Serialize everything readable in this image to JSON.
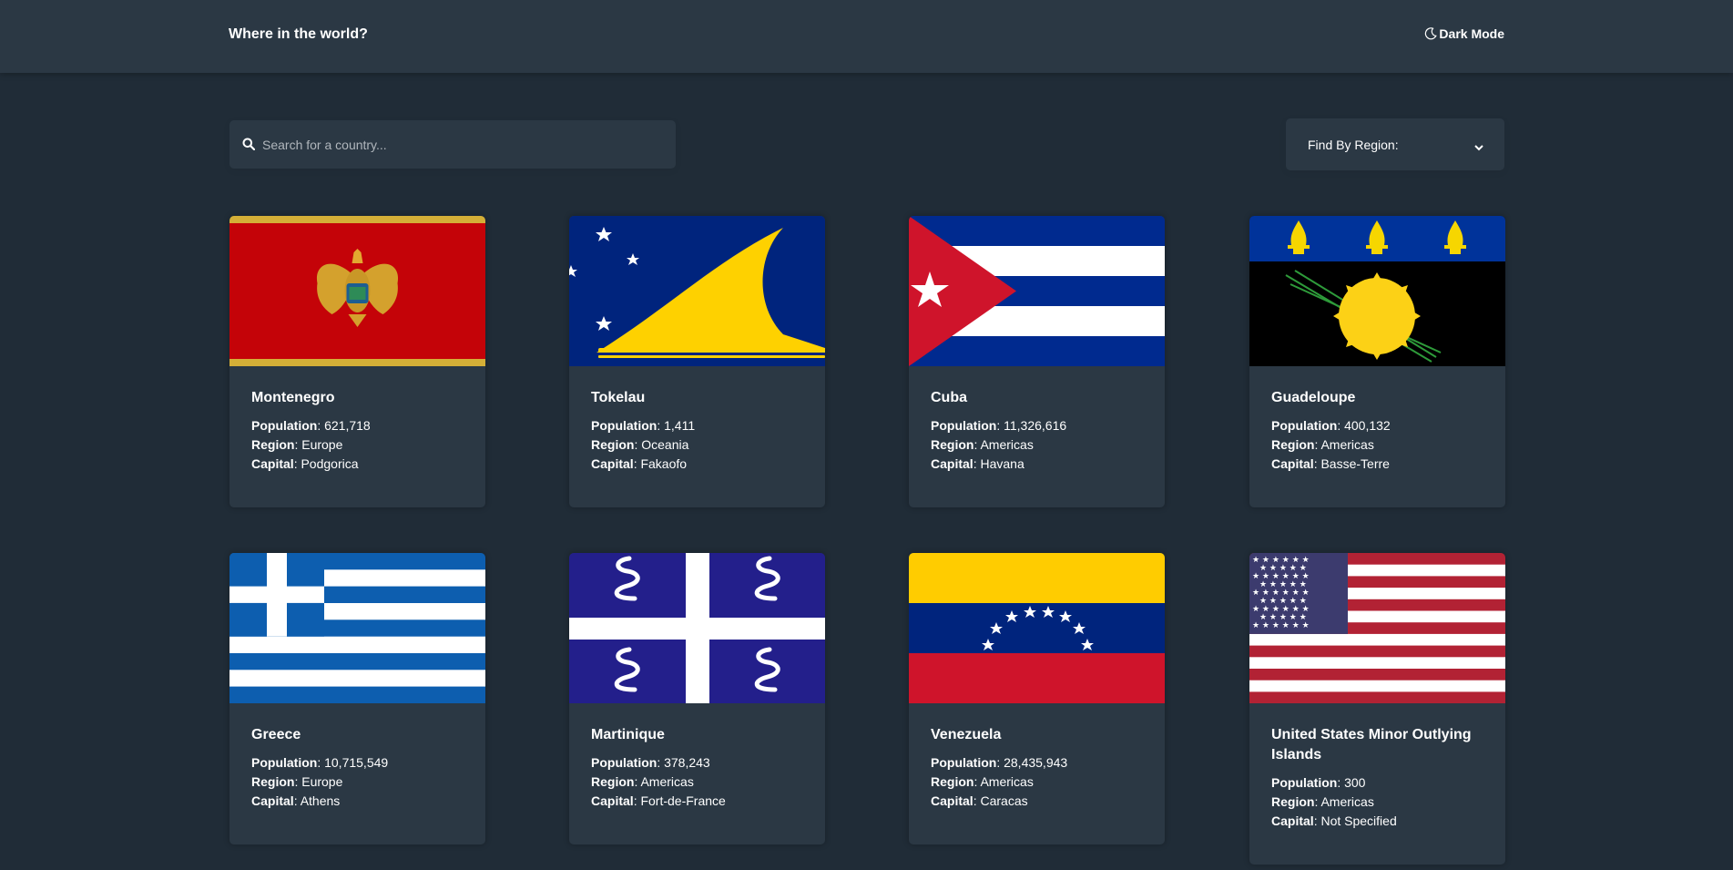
{
  "header": {
    "title": "Where in the world?",
    "mode_label": "Dark Mode",
    "mode_icon": "moon-icon"
  },
  "search": {
    "placeholder": "Search for a country...",
    "value": "",
    "icon": "search-icon"
  },
  "filter": {
    "label": "Find By Region:",
    "icon": "chevron-down-icon"
  },
  "labels": {
    "population": "Population",
    "region": "Region",
    "capital": "Capital"
  },
  "countries": [
    {
      "name": "Montenegro",
      "population": "621,718",
      "region": "Europe",
      "capital": "Podgorica",
      "flag": "montenegro-flag"
    },
    {
      "name": "Tokelau",
      "population": "1,411",
      "region": "Oceania",
      "capital": "Fakaofo",
      "flag": "tokelau-flag"
    },
    {
      "name": "Cuba",
      "population": "11,326,616",
      "region": "Americas",
      "capital": "Havana",
      "flag": "cuba-flag"
    },
    {
      "name": "Guadeloupe",
      "population": "400,132",
      "region": "Americas",
      "capital": "Basse-Terre",
      "flag": "guadeloupe-flag"
    },
    {
      "name": "Greece",
      "population": "10,715,549",
      "region": "Europe",
      "capital": "Athens",
      "flag": "greece-flag"
    },
    {
      "name": "Martinique",
      "population": "378,243",
      "region": "Americas",
      "capital": "Fort-de-France",
      "flag": "martinique-flag"
    },
    {
      "name": "Venezuela",
      "population": "28,435,943",
      "region": "Americas",
      "capital": "Caracas",
      "flag": "venezuela-flag"
    },
    {
      "name": "United States Minor Outlying Islands",
      "population": "300",
      "region": "Americas",
      "capital": "Not Specified",
      "flag": "us-minor-outlying-islands-flag"
    }
  ],
  "colors": {
    "background": "#202c37",
    "element": "#2b3844",
    "text": "#ffffff"
  }
}
